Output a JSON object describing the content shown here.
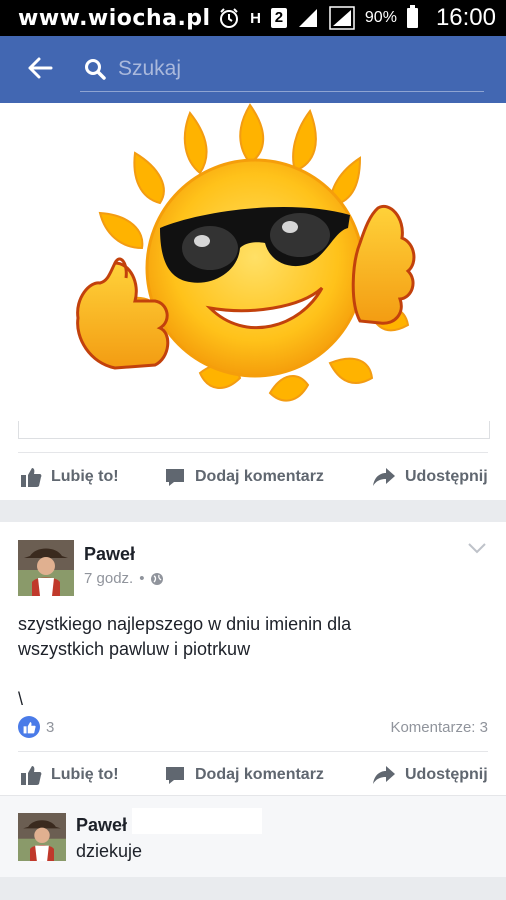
{
  "status_bar": {
    "watermark": "www.wiocha.pl",
    "network_h": "H",
    "sim_slot": "2",
    "battery": "90%",
    "time": "16:00"
  },
  "header": {
    "search_placeholder": "Szukaj"
  },
  "shared_post": {
    "actions": {
      "like": "Lubię to!",
      "comment": "Dodaj komentarz",
      "share": "Udostępnij"
    }
  },
  "post": {
    "author": "Paweł",
    "time": "7 godz.",
    "separator": "•",
    "text": "szystkiego najlepszego w dniu imienin dla\nwszystkich pawluw i piotrkuw\n\n\\",
    "likes": "3",
    "comments_label": "Komentarze: 3",
    "actions": {
      "like": "Lubię to!",
      "comment": "Dodaj komentarz",
      "share": "Udostępnij"
    }
  },
  "comment": {
    "author": "Paweł",
    "text": "dziekuje"
  },
  "colors": {
    "header_bg": "#4267b2",
    "page_bg": "#e9ebee",
    "action_text": "#606770",
    "like_blue": "#4a7be8"
  }
}
